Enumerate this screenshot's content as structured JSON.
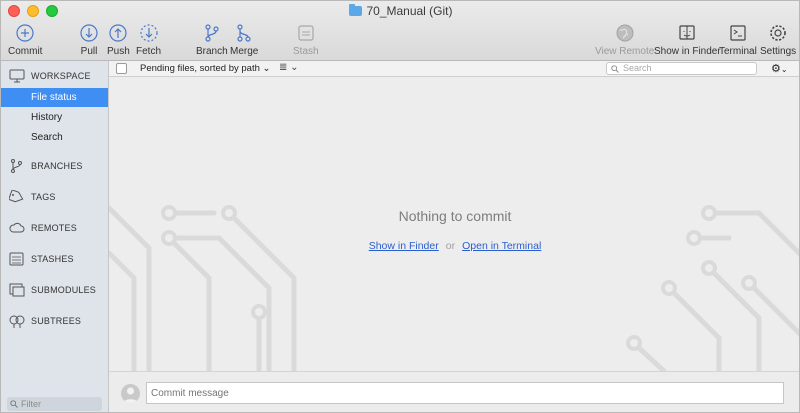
{
  "window": {
    "title": "70_Manual (Git)"
  },
  "toolbar": {
    "commit": "Commit",
    "pull": "Pull",
    "push": "Push",
    "fetch": "Fetch",
    "branch": "Branch",
    "merge": "Merge",
    "stash": "Stash",
    "view_remote": "View Remote",
    "show_in_finder": "Show in Finder",
    "terminal": "Terminal",
    "settings": "Settings"
  },
  "sidebar": {
    "workspace": "WORKSPACE",
    "workspace_items": [
      {
        "label": "File status",
        "selected": true
      },
      {
        "label": "History",
        "selected": false
      },
      {
        "label": "Search",
        "selected": false
      }
    ],
    "sections": {
      "branches": "BRANCHES",
      "tags": "TAGS",
      "remotes": "REMOTES",
      "stashes": "STASHES",
      "submodules": "SUBMODULES",
      "subtrees": "SUBTREES"
    },
    "filter_placeholder": "Filter"
  },
  "filebar": {
    "pending_label": "Pending files, sorted by path",
    "search_placeholder": "Search"
  },
  "main": {
    "empty_title": "Nothing to commit",
    "show_in_finder_link": "Show in Finder",
    "or_text": "or",
    "open_terminal_link": "Open in Terminal"
  },
  "commit": {
    "placeholder": "Commit message"
  },
  "colors": {
    "selection": "#3f8ef3",
    "link": "#2a5fcf",
    "sidebar_bg": "#dfe4ea",
    "toolbar_icon": "#4a79c8"
  }
}
